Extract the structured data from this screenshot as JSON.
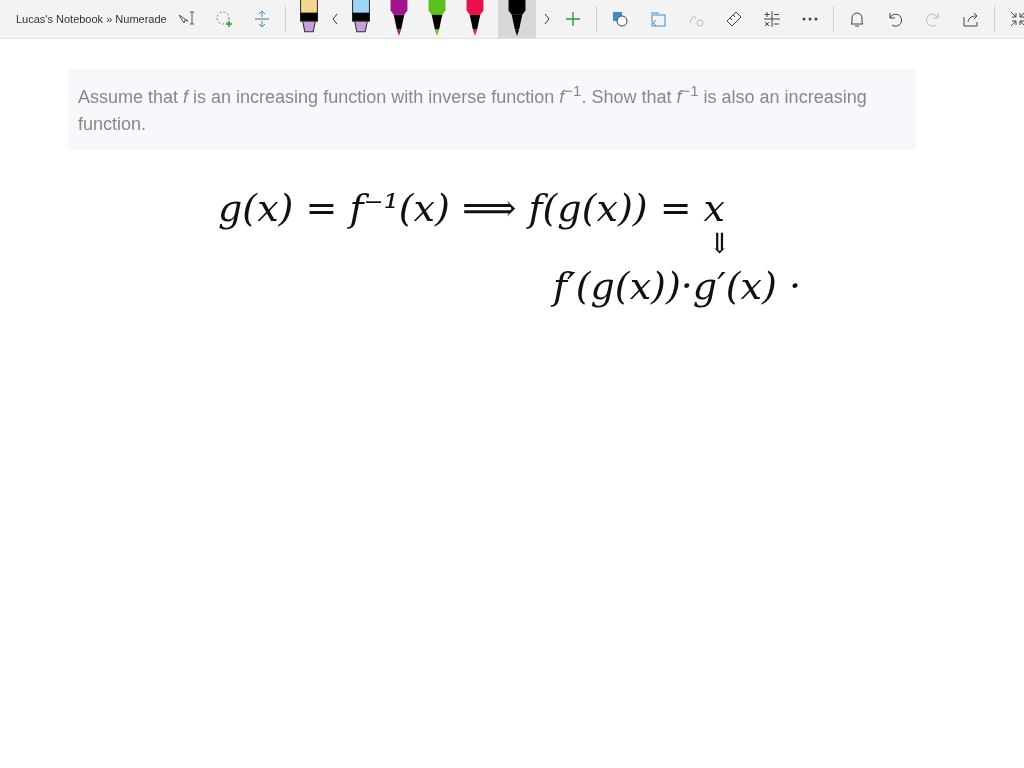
{
  "window": {
    "title": "Lucas's Notebook » Numerade"
  },
  "pens": [
    {
      "kind": "highlighter",
      "color": "#f4d58d",
      "selected": false
    },
    {
      "kind": "highlighter",
      "color": "#9ed4f5",
      "selected": false
    },
    {
      "kind": "pen",
      "color": "#a0148c",
      "selected": false
    },
    {
      "kind": "pen",
      "color": "#5cc11e",
      "selected": false
    },
    {
      "kind": "pen",
      "color": "#e8124a",
      "selected": false
    },
    {
      "kind": "pen",
      "color": "#000000",
      "selected": true
    }
  ],
  "question": "Assume that *f* is an increasing function with inverse function *f*$^{−1}$. Show that *f*$^{−1}$ is also an increasing function.",
  "ink": [
    {
      "kind": "line",
      "text": "g(x) = f⁻¹(x) ⟹ f(g(x)) = x"
    },
    {
      "kind": "arrow",
      "text": "⇓"
    },
    {
      "kind": "line",
      "text": "f′(g(x))·g′(x) ·"
    }
  ]
}
